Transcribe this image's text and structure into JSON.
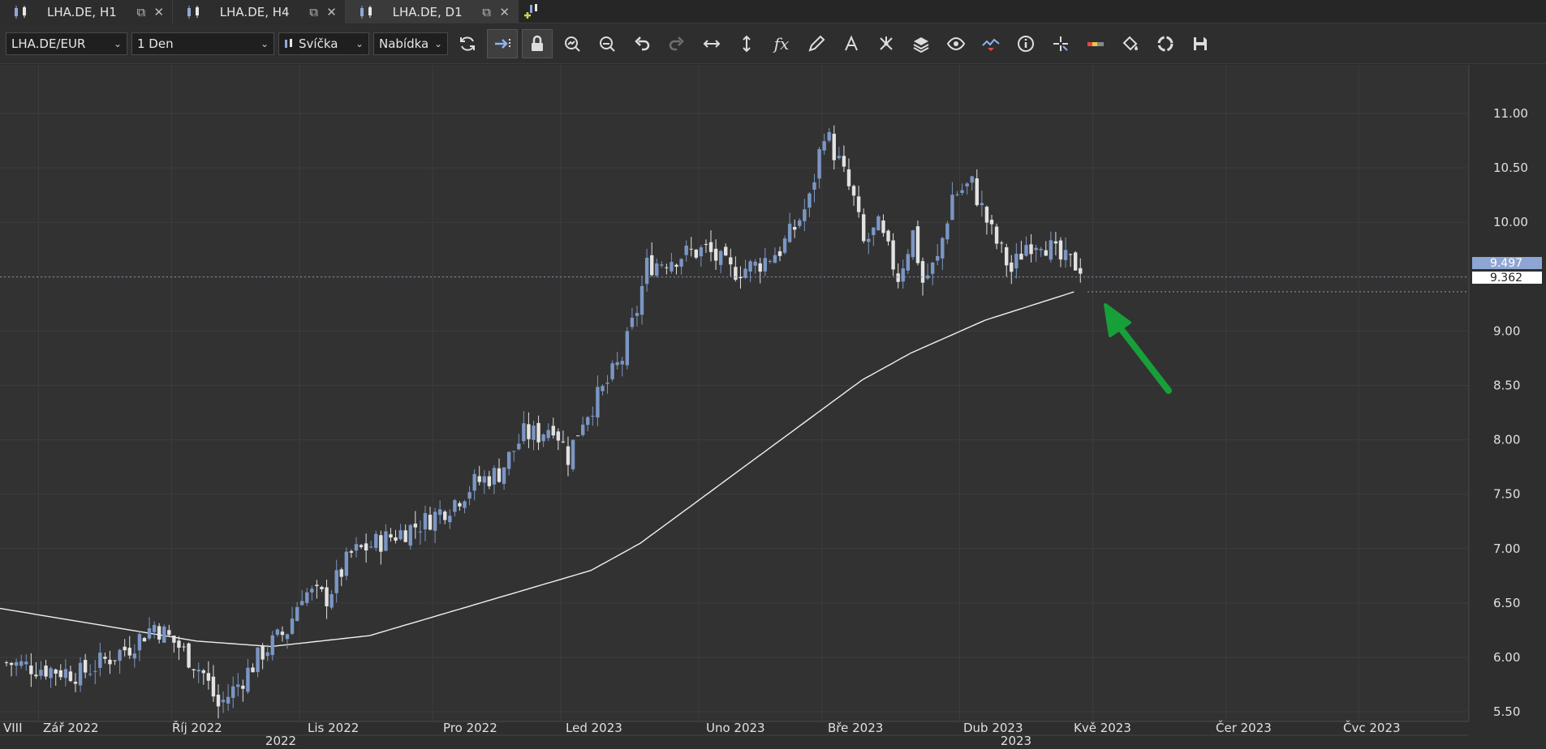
{
  "tabs": [
    {
      "label": "LHA.DE, H1",
      "active": false
    },
    {
      "label": "LHA.DE, H4",
      "active": false
    },
    {
      "label": "LHA.DE, D1",
      "active": true
    }
  ],
  "toolbar": {
    "symbol": "LHA.DE/EUR",
    "timeframe": "1 Den",
    "chart_type": "Svíčka",
    "price_side": "Nabídka",
    "fx_label": "fx"
  },
  "colors": {
    "background": "#323232",
    "grid": "#3d3d3d",
    "bull": "#7b96c4",
    "bear": "#e2e2e2",
    "ma_line": "#f0f0f0",
    "arrow": "#17a03a",
    "current_price_tag": "#8ea6d4"
  },
  "chart_data": {
    "type": "candlestick",
    "y_ticks": [
      "11.00",
      "10.50",
      "10.00",
      "9.50",
      "9.00",
      "8.50",
      "8.00",
      "7.50",
      "7.00",
      "6.50",
      "6.00",
      "5.50"
    ],
    "x_month_labels": [
      "VIII",
      "Zář 2022",
      "Říj 2022",
      "Lis 2022",
      "Pro 2022",
      "Led 2023",
      "Uno 2023",
      "Bře 2023",
      "Dub 2023",
      "Kvě 2023",
      "Čer 2023",
      "Čvc 2023"
    ],
    "x_year_labels": [
      "2022",
      "2023"
    ],
    "price_tags": {
      "current": "9.497",
      "ma": "9.362"
    },
    "ylim": [
      5.5,
      11.0
    ],
    "anchors": [
      [
        0,
        5.95
      ],
      [
        15,
        5.85
      ],
      [
        25,
        6.1
      ],
      [
        30,
        6.3
      ],
      [
        35,
        6.1
      ],
      [
        40,
        5.85
      ],
      [
        43,
        5.55
      ],
      [
        47,
        5.75
      ],
      [
        52,
        6.05
      ],
      [
        57,
        6.25
      ],
      [
        60,
        6.6
      ],
      [
        65,
        6.55
      ],
      [
        70,
        6.95
      ],
      [
        75,
        7.05
      ],
      [
        80,
        7.15
      ],
      [
        85,
        7.25
      ],
      [
        90,
        7.4
      ],
      [
        95,
        7.6
      ],
      [
        100,
        7.7
      ],
      [
        105,
        8.05
      ],
      [
        108,
        8.05
      ],
      [
        111,
        8.15
      ],
      [
        114,
        7.85
      ],
      [
        117,
        8.2
      ],
      [
        121,
        8.45
      ],
      [
        125,
        8.75
      ],
      [
        128,
        9.2
      ],
      [
        130,
        9.6
      ],
      [
        137,
        9.7
      ],
      [
        142,
        9.75
      ],
      [
        147,
        9.55
      ],
      [
        152,
        9.6
      ],
      [
        157,
        9.75
      ],
      [
        160,
        9.95
      ],
      [
        163,
        10.2
      ],
      [
        166,
        10.85
      ],
      [
        169,
        10.55
      ],
      [
        172,
        10.2
      ],
      [
        174,
        9.8
      ],
      [
        177,
        9.95
      ],
      [
        181,
        9.5
      ],
      [
        184,
        9.9
      ],
      [
        186,
        9.45
      ],
      [
        189,
        9.65
      ],
      [
        192,
        10.25
      ],
      [
        196,
        10.35
      ],
      [
        200,
        9.9
      ],
      [
        204,
        9.55
      ],
      [
        207,
        9.8
      ],
      [
        210,
        9.85
      ],
      [
        214,
        9.65
      ],
      [
        218,
        9.6
      ]
    ],
    "ma_points": [
      [
        0,
        6.45
      ],
      [
        20,
        6.3
      ],
      [
        40,
        6.15
      ],
      [
        55,
        6.1
      ],
      [
        75,
        6.2
      ],
      [
        90,
        6.4
      ],
      [
        105,
        6.6
      ],
      [
        120,
        6.8
      ],
      [
        130,
        7.05
      ],
      [
        145,
        7.55
      ],
      [
        160,
        8.05
      ],
      [
        175,
        8.55
      ],
      [
        185,
        8.8
      ],
      [
        200,
        9.1
      ],
      [
        218,
        9.36
      ]
    ],
    "month_boundaries": [
      7,
      34,
      60,
      87,
      113,
      141,
      166,
      194,
      221,
      248,
      275
    ],
    "bars_total": 294
  }
}
